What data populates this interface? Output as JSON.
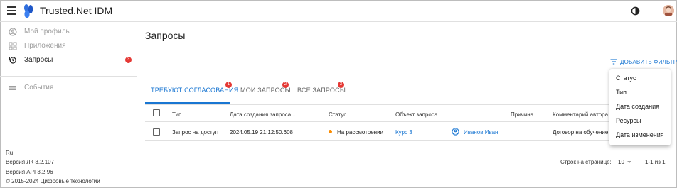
{
  "app": {
    "title": "Trusted.Net IDM"
  },
  "sidebar": {
    "items": [
      {
        "label": "Мой профиль",
        "icon": "account-circle-icon",
        "active": false
      },
      {
        "label": "Приложения",
        "icon": "apps-grid-icon",
        "active": false
      },
      {
        "label": "Запросы",
        "icon": "history-icon",
        "active": true,
        "badge": "3"
      },
      {
        "label": "События",
        "icon": "list-icon",
        "active": false
      }
    ],
    "footer": {
      "language": "Ru",
      "lk_version": "Версия ЛК 3.2.107",
      "api_version": "Версия API 3.2.96",
      "copyright": "© 2015-2024 Цифровые технологии"
    }
  },
  "main": {
    "title": "Запросы",
    "add_filter_label": "ДОБАВИТЬ ФИЛЬТР",
    "tabs": [
      {
        "label": "ТРЕБУЮТ СОГЛАСОВАНИЯ",
        "badge": "1",
        "active": true
      },
      {
        "label": "МОИ ЗАПРОСЫ",
        "badge": "2",
        "active": false
      },
      {
        "label": "ВСЕ ЗАПРОСЫ",
        "badge": "3",
        "active": false
      }
    ],
    "table": {
      "columns": [
        "Тип",
        "Дата создания запроса",
        "Статус",
        "Объект запроса",
        "Причина",
        "Комментарий автора"
      ],
      "sort_indicator": "↓",
      "rows": [
        {
          "type": "Запрос на доступ",
          "created": "2024.05.19 21:12:50.608",
          "status": "На рассмотрении",
          "object": "Курс 3",
          "user": "Иванов Иван",
          "reason": "",
          "comment": "Договор на обучение"
        }
      ]
    },
    "pagination": {
      "rows_per_page_label": "Строк на странице:",
      "rows_per_page_value": "10",
      "range": "1-1 из 1"
    }
  },
  "filter_menu": {
    "options": [
      "Статус",
      "Тип",
      "Дата создания",
      "Ресурсы",
      "Дата изменения"
    ]
  },
  "colors": {
    "accent": "#1976d2",
    "badge": "#e53935",
    "status_pending": "#fb8c00"
  }
}
